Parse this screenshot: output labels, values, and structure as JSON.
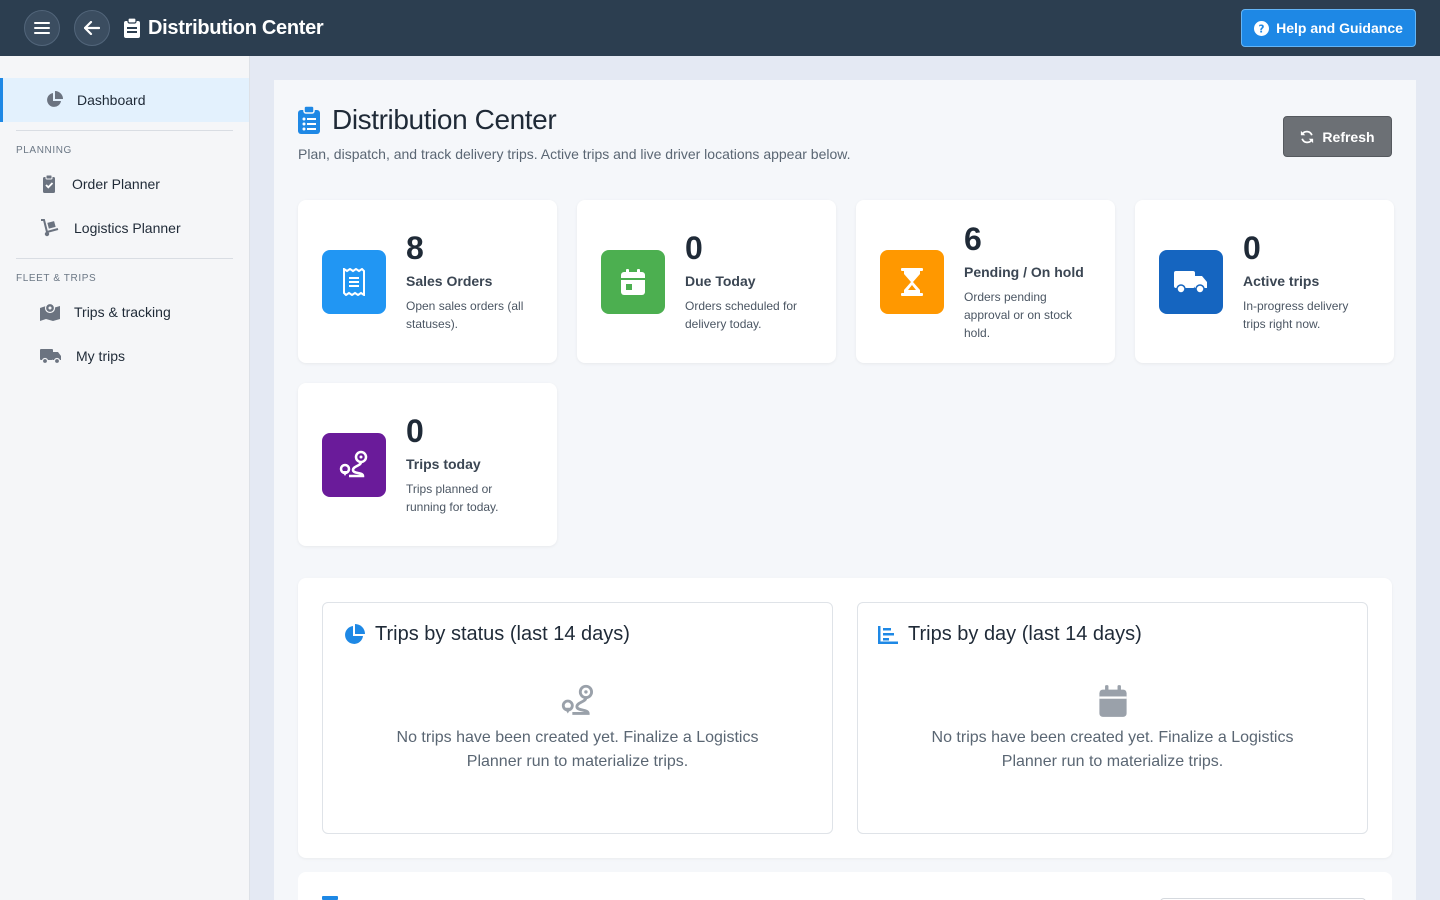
{
  "topbar": {
    "title": "Distribution Center",
    "help_label": "Help and Guidance"
  },
  "sidebar": {
    "dashboard": "Dashboard",
    "sections": [
      {
        "title": "PLANNING",
        "items": [
          "Order Planner",
          "Logistics Planner"
        ]
      },
      {
        "title": "FLEET & TRIPS",
        "items": [
          "Trips & tracking",
          "My trips"
        ]
      }
    ]
  },
  "main": {
    "title": "Distribution Center",
    "subtitle": "Plan, dispatch, and track delivery trips. Active trips and live driver locations appear below.",
    "refresh_label": "Refresh"
  },
  "cards": [
    {
      "value": "8",
      "label": "Sales Orders",
      "desc": "Open sales orders (all statuses).",
      "color": "#2196f3",
      "icon": "receipt-icon"
    },
    {
      "value": "0",
      "label": "Due Today",
      "desc": "Orders scheduled for delivery today.",
      "color": "#4caf50",
      "icon": "calendar-icon"
    },
    {
      "value": "6",
      "label": "Pending / On hold",
      "desc": "Orders pending approval or on stock hold.",
      "color": "#ff9800",
      "icon": "hourglass-icon"
    },
    {
      "value": "0",
      "label": "Active trips",
      "desc": "In-progress delivery trips right now.",
      "color": "#1565c0",
      "icon": "truck-icon"
    },
    {
      "value": "0",
      "label": "Trips today",
      "desc": "Trips planned or running for today.",
      "color": "#6a1b9a",
      "icon": "route-icon"
    }
  ],
  "charts": [
    {
      "title": "Trips by status (last 14 days)",
      "empty": "No trips have been created yet. Finalize a Logistics Planner run to materialize trips.",
      "icon": "pie-chart-icon"
    },
    {
      "title": "Trips by day (last 14 days)",
      "empty": "No trips have been created yet. Finalize a Logistics Planner run to materialize trips.",
      "icon": "bar-chart-icon"
    }
  ]
}
